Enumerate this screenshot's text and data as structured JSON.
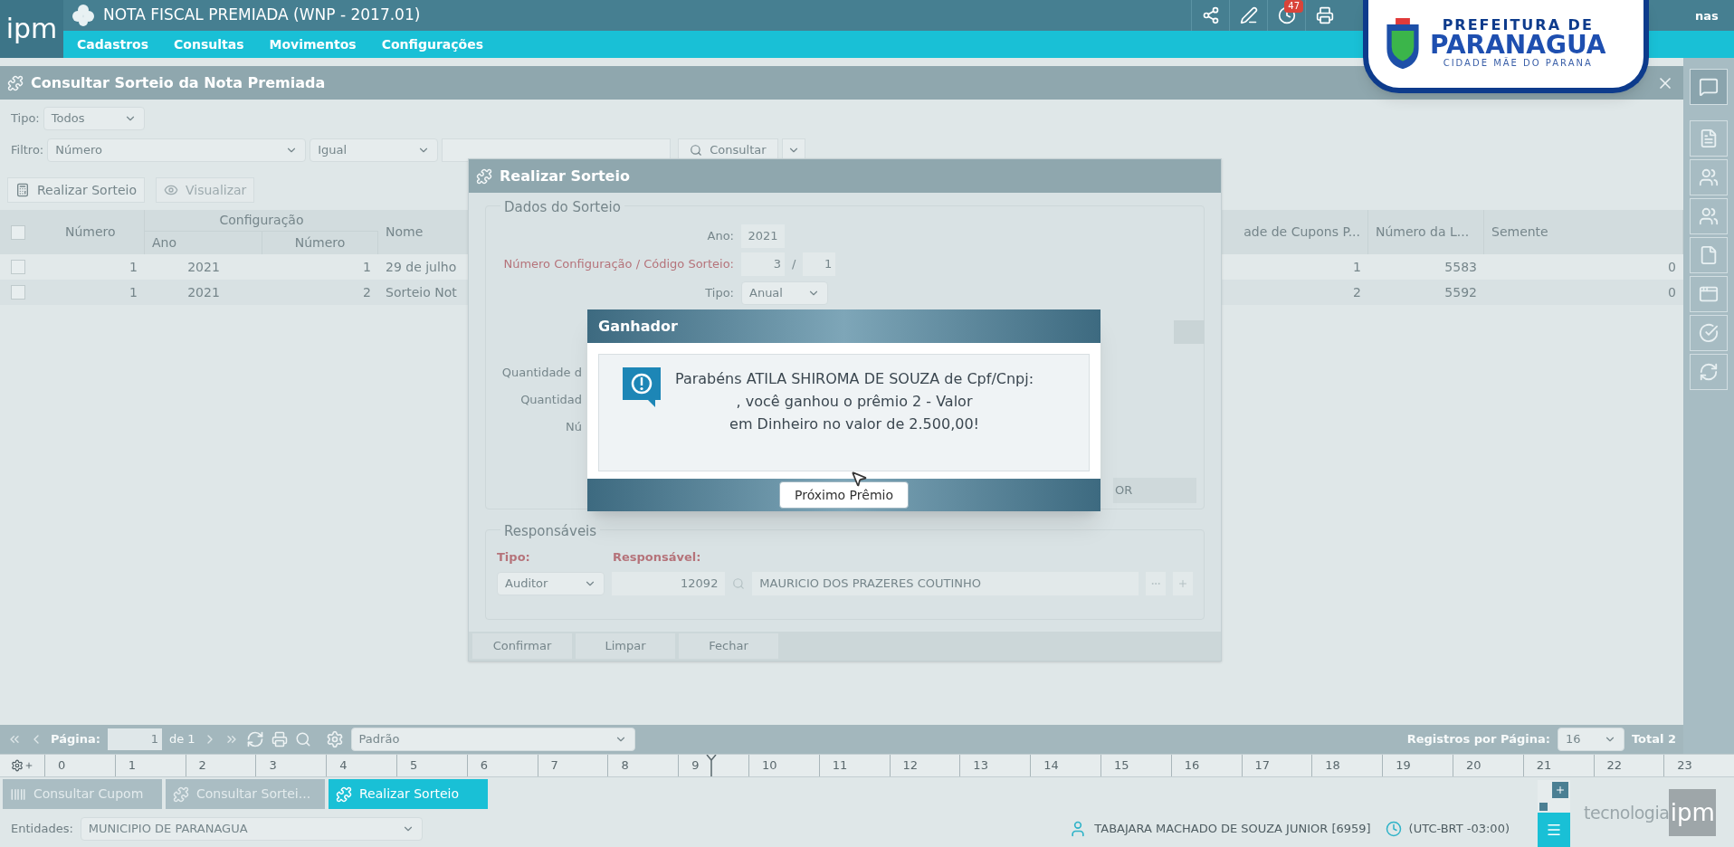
{
  "app": {
    "logo": "ipm",
    "title": "NOTA FISCAL PREMIADA (WNP - 2017.01)",
    "menu": [
      "Cadastros",
      "Consultas",
      "Movimentos",
      "Configurações"
    ],
    "notification_count": "47",
    "user_menu_fragment": "nas"
  },
  "city_badge": {
    "line1": "PREFEITURA DE",
    "line2": "PARANAGUA",
    "line3": "CIDADE MÃE DO PARANA"
  },
  "window": {
    "title": "Consultar Sorteio da Nota Premiada"
  },
  "filters": {
    "tipo_label": "Tipo:",
    "tipo_value": "Todos",
    "filtro_label": "Filtro:",
    "field": "Número",
    "operator": "Igual",
    "search_button": "Consultar"
  },
  "toolbar": [
    {
      "label": "Realizar Sorteio",
      "disabled": false
    },
    {
      "label": "Visualizar",
      "disabled": true
    }
  ],
  "table": {
    "header_checked": false,
    "columns": {
      "numero": "Número",
      "group": "Configuração",
      "ano": "Ano",
      "config_numero": "Número",
      "nome": "Nome",
      "cupons": "ade de Cupons P...",
      "loteria": "Número da L...",
      "semente": "Semente"
    },
    "rows": [
      {
        "checked": false,
        "numero": "1",
        "ano": "2021",
        "config_numero": "1",
        "nome": "29 de julho",
        "cupons": "1",
        "loteria": "5583",
        "semente": "0"
      },
      {
        "checked": false,
        "numero": "1",
        "ano": "2021",
        "config_numero": "2",
        "nome": "Sorteio Not",
        "cupons": "2",
        "loteria": "5592",
        "semente": "0"
      }
    ]
  },
  "draw_dialog": {
    "title": "Realizar Sorteio",
    "section": "Dados do Sorteio",
    "ano_label": "Ano:",
    "ano": "2021",
    "config_label": "Número Configuração / Código Sorteio:",
    "config_number": "3",
    "separator": "/",
    "draw_code": "1",
    "tipo_label": "Tipo:",
    "tipo": "Anual",
    "hidden_labels": [
      "Quantidade d",
      "Quantidad",
      "Nú"
    ],
    "side_button_fragment": "OR",
    "responsaveis": {
      "title": "Responsáveis",
      "tipo_label": "Tipo:",
      "responsavel_label": "Responsável:",
      "tipo": "Auditor",
      "codigo": "12092",
      "nome": "MAURICIO DOS PRAZERES COUTINHO"
    },
    "buttons": [
      "Confirmar",
      "Limpar",
      "Fechar"
    ]
  },
  "winner_dialog": {
    "title": "Ganhador",
    "message_lines": [
      "Parabéns ATILA SHIROMA DE SOUZA de Cpf/Cnpj:",
      ", você ganhou o prêmio 2 - Valor",
      "em Dinheiro no valor de 2.500,00!"
    ],
    "button": "Próximo Prêmio"
  },
  "pager": {
    "page_label": "Página:",
    "page": "1",
    "of": "de 1",
    "layout": "Padrão",
    "per_page_label": "Registros por Página:",
    "per_page": "16",
    "total": "Total 2"
  },
  "timeline": {
    "ticks": [
      "0",
      "1",
      "2",
      "3",
      "4",
      "5",
      "6",
      "7",
      "8",
      "9",
      "10",
      "11",
      "12",
      "13",
      "14",
      "15",
      "16",
      "17",
      "18",
      "19",
      "20",
      "21",
      "22",
      "23"
    ],
    "level": 0.395
  },
  "taskbar": [
    {
      "label": "Consultar Cupom",
      "selected": false,
      "kind": "barcode"
    },
    {
      "label": "Consultar Sortei...",
      "selected": false,
      "kind": "puzzle"
    },
    {
      "label": "Realizar Sorteio",
      "selected": true,
      "kind": "puzzle"
    }
  ],
  "status": {
    "entities_label": "Entidades:",
    "entity": "MUNICIPIO DE PARANAGUA",
    "user": "TABAJARA MACHADO DE SOUZA JUNIOR [6959]",
    "timezone": "(UTC-BRT -03:00)"
  },
  "brand": {
    "word": "tecnologia",
    "logo": "ipm"
  }
}
